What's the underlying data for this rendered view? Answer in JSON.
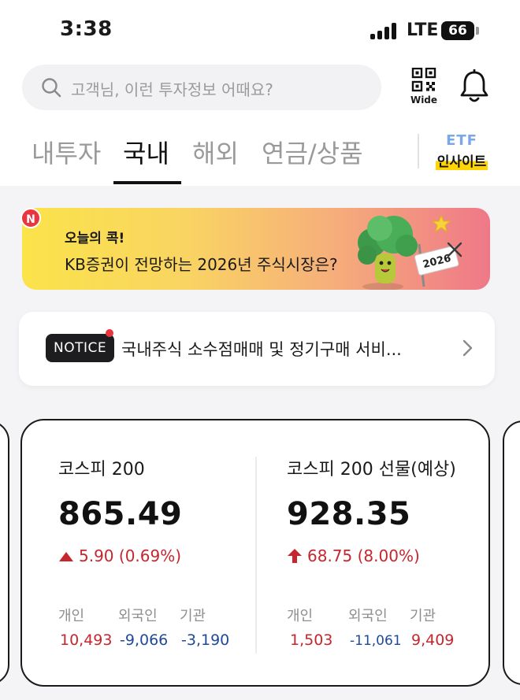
{
  "status_bar": {
    "time": "3:38",
    "network": "LTE",
    "battery": "66"
  },
  "search": {
    "placeholder": "고객님, 이런 투자정보 어때요?"
  },
  "header": {
    "qr_label": "Wide"
  },
  "tabs": [
    {
      "label": "내투자",
      "active": false
    },
    {
      "label": "국내",
      "active": true
    },
    {
      "label": "해외",
      "active": false
    },
    {
      "label": "연금/상품",
      "active": false
    }
  ],
  "etf_insight": {
    "top": "ETF",
    "bottom": "인사이트"
  },
  "banner": {
    "badge": "N",
    "tag": "오늘의 콕!",
    "title": "KB증권이 전망하는 2026년 주식시장은?",
    "sign": "2026"
  },
  "notice": {
    "badge": "NOTICE",
    "text": "국내주식 소수점매매 및 정기구매 서비..."
  },
  "market": [
    {
      "name": "코스피 200",
      "value": "865.49",
      "change": "5.90 (0.69%)",
      "direction": "up",
      "arrow_style": "triangle",
      "investors": [
        {
          "label": "개인",
          "value": "10,493",
          "color": "red"
        },
        {
          "label": "외국인",
          "value": "-9,066",
          "color": "blue"
        },
        {
          "label": "기관",
          "value": "-3,190",
          "color": "blue"
        }
      ]
    },
    {
      "name": "코스피 200 선물(예상)",
      "value": "928.35",
      "change": "68.75 (8.00%)",
      "direction": "up",
      "arrow_style": "arrow",
      "investors": [
        {
          "label": "개인",
          "value": "1,503",
          "color": "red"
        },
        {
          "label": "외국인",
          "value": "-11,061",
          "color": "blue"
        },
        {
          "label": "기관",
          "value": "9,409",
          "color": "red"
        }
      ]
    }
  ],
  "colors": {
    "up": "#c6262e",
    "down": "#1f4a9a",
    "badge_red": "#e8353f"
  }
}
